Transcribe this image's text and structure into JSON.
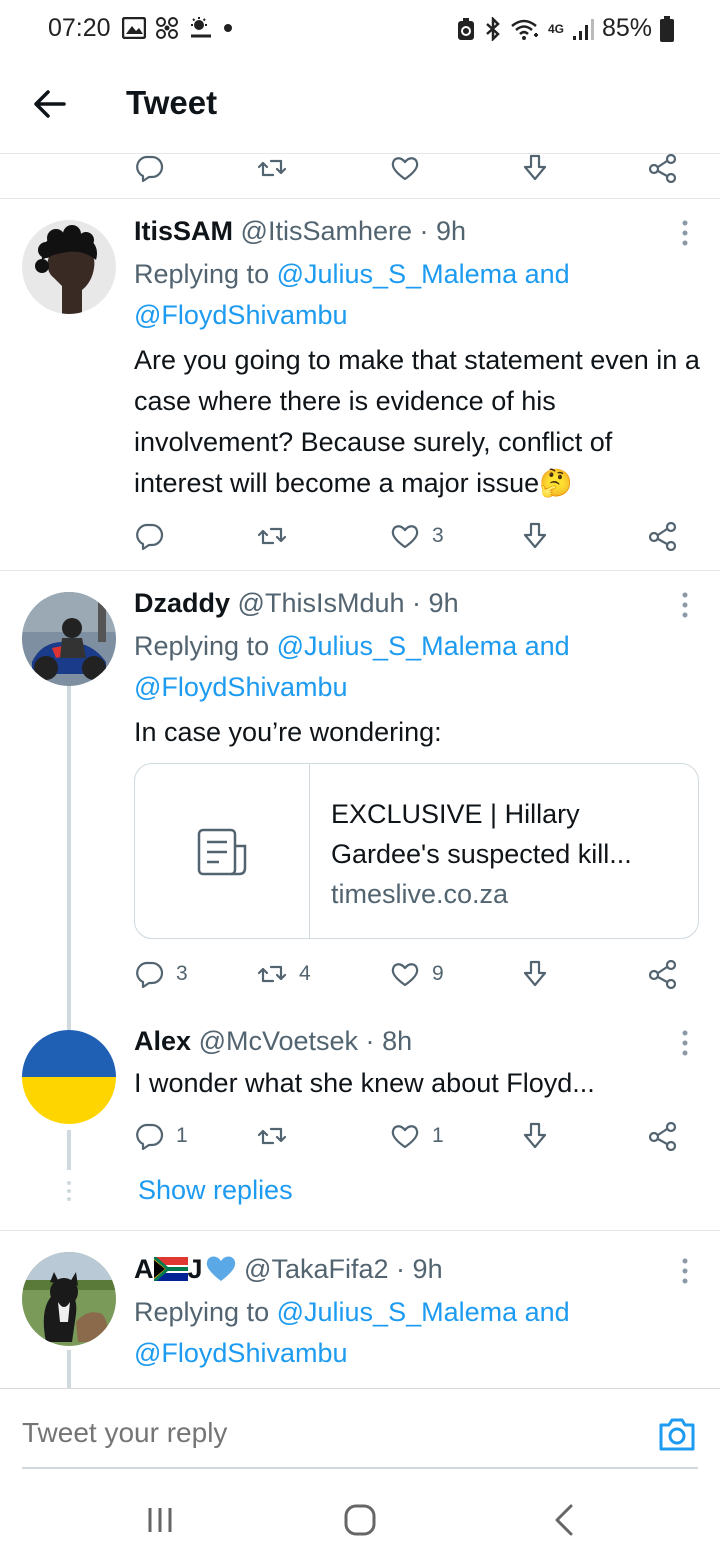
{
  "status_bar": {
    "time": "07:20",
    "network": "4G",
    "battery": "85%"
  },
  "header": {
    "title": "Tweet"
  },
  "tweets": [
    {
      "name": "ItisSAM",
      "handle": "@ItisSamhere",
      "sep": "·",
      "time": "9h",
      "replying_prefix": "Replying to",
      "replying_to": "@Julius_S_Malema and",
      "replying_to_2": "@FloydShivambu",
      "text": "Are you going to make that statement even in a case where there is evidence of his involvement? Because surely, conflict of interest will become a major issue",
      "emoji": "🤔",
      "likes": "3"
    },
    {
      "name": "Dzaddy",
      "handle": "@ThisIsMduh",
      "sep": "·",
      "time": "9h",
      "replying_prefix": "Replying to",
      "replying_to": "@Julius_S_Malema and",
      "replying_to_2": "@FloydShivambu",
      "text": "In case you’re wondering:",
      "card": {
        "title": "EXCLUSIVE | Hillary Gardee's suspected kill...",
        "domain": "timeslive.co.za"
      },
      "replies": "3",
      "retweets": "4",
      "likes": "9"
    },
    {
      "name": "Alex",
      "handle": "@McVoetsek",
      "sep": "·",
      "time": "8h",
      "text": "I wonder what she knew about Floyd...",
      "replies": "1",
      "likes": "1",
      "show_replies": "Show replies"
    },
    {
      "name_a": "A",
      "name_j": "J",
      "handle": "@TakaFifa2",
      "sep": "·",
      "time": "9h",
      "replying_prefix": "Replying to",
      "replying_to": "@Julius_S_Malema and",
      "replying_to_2": "@FloydShivambu"
    }
  ],
  "compose": {
    "placeholder": "Tweet your reply"
  },
  "colors": {
    "accent": "#1d9bf0",
    "secondary_text": "#536471",
    "ukraine_blue": "#1f5fb4",
    "ukraine_yellow": "#ffd500"
  },
  "icons": [
    "back-arrow-icon",
    "reply-icon",
    "retweet-icon",
    "heart-icon",
    "bookmark-download-icon",
    "share-icon",
    "more-dots-icon",
    "camera-icon",
    "article-icon"
  ]
}
